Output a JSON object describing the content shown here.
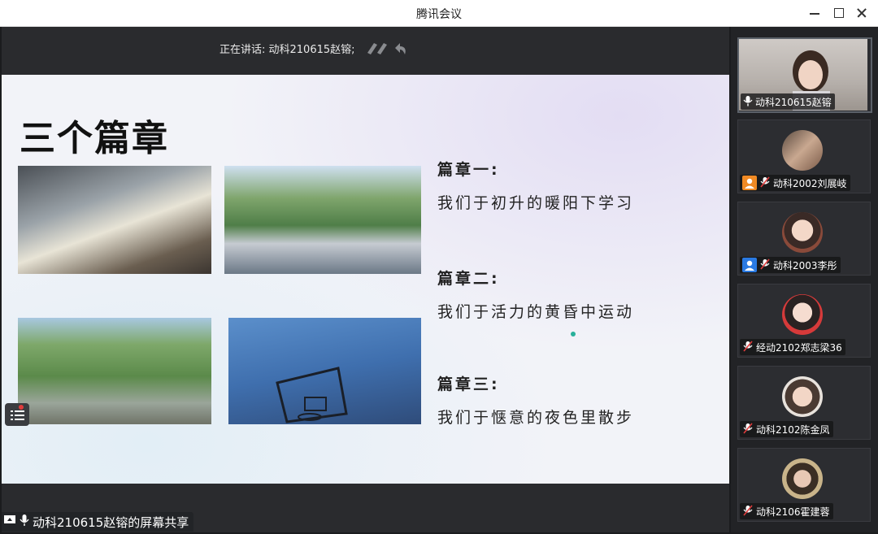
{
  "window": {
    "title": "腾讯会议"
  },
  "stage": {
    "speaking_text": "正在讲话: 动科210615赵镕;"
  },
  "slide": {
    "title": "三个篇章",
    "chapters": [
      {
        "heading": "篇章一:",
        "text": "我们于初升的暖阳下学习"
      },
      {
        "heading": "篇章二:",
        "text": "我们于活力的黄昏中运动"
      },
      {
        "heading": "篇章三:",
        "text": "我们于惬意的夜色里散步"
      }
    ]
  },
  "share_label": "动科210615赵镕的屏幕共享",
  "participants": [
    {
      "name": "动科210615赵镕",
      "role": "",
      "muted": false
    },
    {
      "name": "动科2002刘展岐",
      "role": "host",
      "muted": true
    },
    {
      "name": "动科2003李彤",
      "role": "cohost",
      "muted": true
    },
    {
      "name": "经动2102郑志梁36",
      "role": "",
      "muted": true
    },
    {
      "name": "动科2102陈金凤",
      "role": "",
      "muted": true
    },
    {
      "name": "动科2106霍建蓉",
      "role": "",
      "muted": true
    }
  ],
  "colors": {
    "role_host": "#f08a24",
    "role_cohost": "#2a7ae2",
    "mute_red": "#e03c3c"
  },
  "icons": [
    "minimize-icon",
    "maximize-icon",
    "close-icon",
    "mic-icon",
    "mic-muted-icon",
    "list-icon",
    "screen-share-icon",
    "user-icon"
  ]
}
